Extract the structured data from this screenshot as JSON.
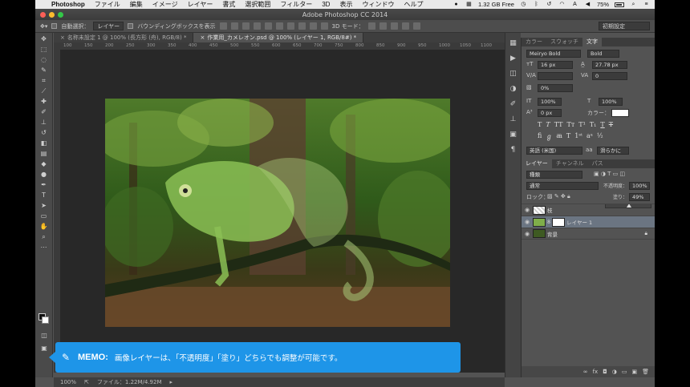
{
  "menubar": {
    "app_name": "Photoshop",
    "items": [
      "ファイル",
      "編集",
      "イメージ",
      "レイヤー",
      "書式",
      "選択範囲",
      "フィルター",
      "3D",
      "表示",
      "ウィンドウ",
      "ヘルプ"
    ],
    "memory": "1.32 GB Free",
    "battery": "75%"
  },
  "window": {
    "title": "Adobe Photoshop CC 2014"
  },
  "options_bar": {
    "auto_select_label": "自動選択：",
    "auto_select_value": "レイヤー",
    "bounding_box_label": "バウンディングボックスを表示",
    "mode_3d_label": "3D モード：",
    "workspace": "初期設定"
  },
  "document_tabs": [
    {
      "label": "名称未設定 1 @ 100% (長方形 (舟), RGB/8) *",
      "active": false
    },
    {
      "label": "作業用_カメレオン.psd @ 100% (レイヤー 1, RGB/8#) *",
      "active": true
    }
  ],
  "ruler_ticks": [
    "100",
    "150",
    "200",
    "250",
    "300",
    "350",
    "400",
    "450",
    "500",
    "550",
    "600",
    "650",
    "700",
    "750",
    "800",
    "850",
    "900",
    "950",
    "1000",
    "1050",
    "1100"
  ],
  "status_bar": {
    "zoom": "100%",
    "file_info": "ファイル：1.22M/4.92M"
  },
  "character_panel": {
    "tabs": [
      "カラー",
      "スウォッチ",
      "文字"
    ],
    "font_family": "Meiryo Bold",
    "font_style": "Bold",
    "font_size": "16 px",
    "leading": "27.78 px",
    "tracking": "0",
    "tsume": "0%",
    "vertical_scale": "100%",
    "horizontal_scale": "100%",
    "baseline_shift": "0 px",
    "color_label": "カラー：",
    "language": "英語 (米国)",
    "anti_alias": "滑らかに"
  },
  "layers_panel": {
    "tabs": [
      "レイヤー",
      "チャンネル",
      "パス"
    ],
    "filter_kind": "種類",
    "blend_mode": "通常",
    "opacity_label": "不透明度：",
    "opacity_value": "100%",
    "lock_label": "ロック：",
    "fill_label": "塗り：",
    "fill_value": "49%",
    "layers": [
      {
        "name": "枝",
        "selected": false
      },
      {
        "name": "レイヤー 1",
        "selected": true
      },
      {
        "name": "背景",
        "selected": false
      }
    ]
  },
  "memo": {
    "label": "MEMO:",
    "text": "画像レイヤーは、「不透明度」「塗り」どちらでも調整が可能です。"
  }
}
